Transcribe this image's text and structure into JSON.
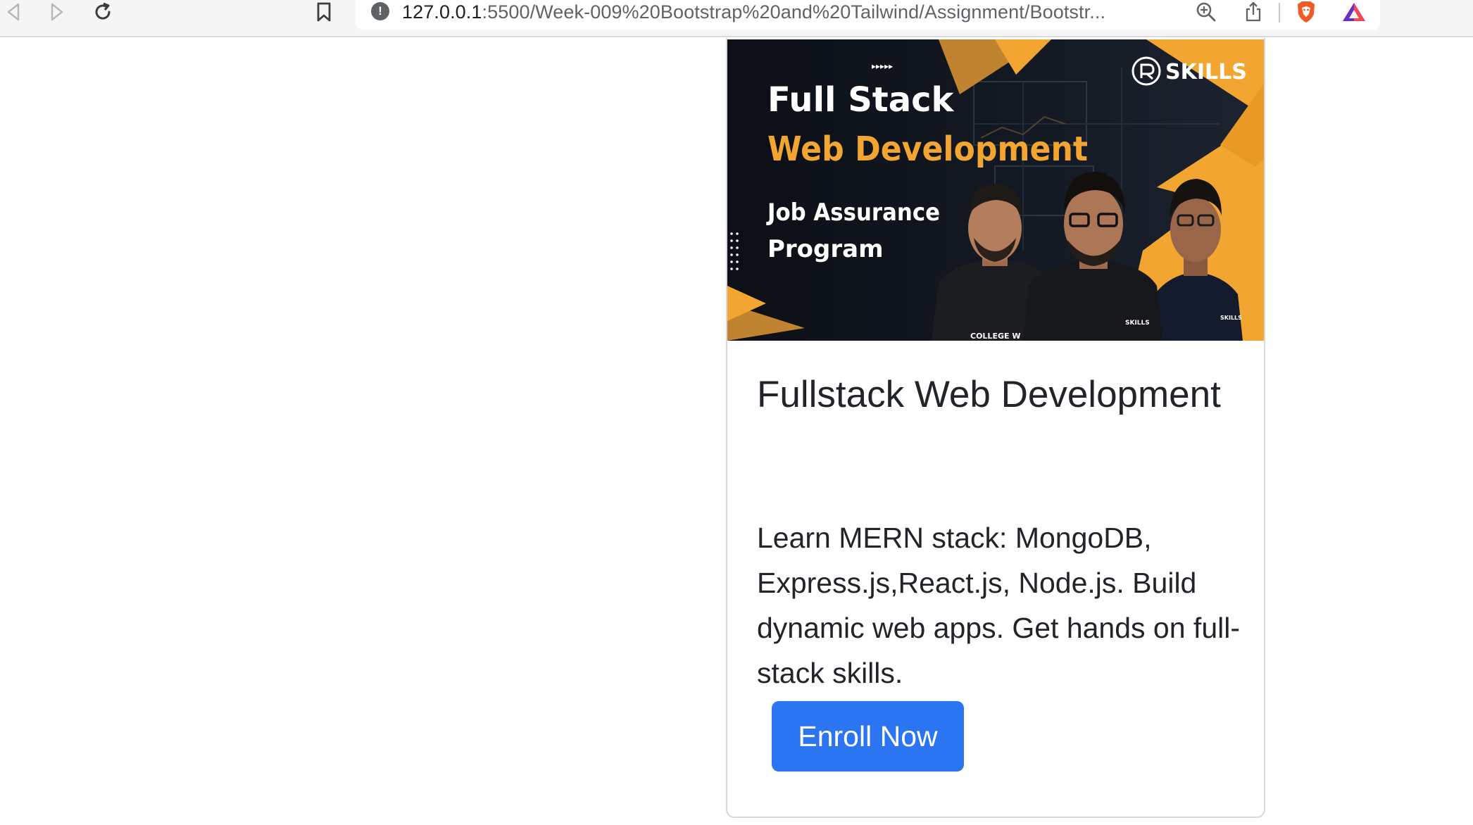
{
  "browser": {
    "url_host": "127.0.0.1",
    "url_path": ":5500/Week-009%20Bootstrap%20and%20Tailwind/Assignment/Bootstr...",
    "info_glyph": "!",
    "icons": [
      "back-icon",
      "forward-icon",
      "reload-icon",
      "bookmark-icon",
      "info-icon",
      "zoom-icon",
      "share-icon",
      "brave-shield-icon",
      "brave-rewards-icon"
    ]
  },
  "banner": {
    "line1": "Full Stack",
    "line2": "Web Development",
    "line3": "Job Assurance",
    "line4": "Program",
    "brand": "SKILLS",
    "shirt_label": "COLLEGE W",
    "shirt_logo": "SKILLS",
    "arrows": "▸▸▸▸▸",
    "colors": {
      "dark": "#10141c",
      "accent": "#f3a531",
      "white": "#ffffff"
    }
  },
  "card": {
    "title": "Fullstack Web Development",
    "text": "Learn MERN stack: MongoDB, Express.js,React.js, Node.js. Build dynamic web apps. Get hands on full-stack skills.",
    "button_label": "Enroll Now",
    "button_color": "#2b75f3"
  }
}
